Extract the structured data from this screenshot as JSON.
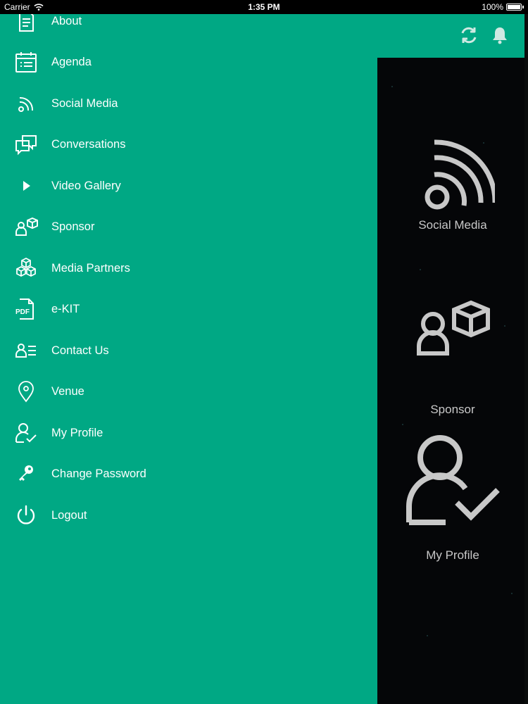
{
  "status_bar": {
    "carrier": "Carrier",
    "time": "1:35 PM",
    "battery": "100%"
  },
  "menu": {
    "items": [
      {
        "label": "About",
        "icon": "document-icon"
      },
      {
        "label": "Agenda",
        "icon": "agenda-icon"
      },
      {
        "label": "Social Media",
        "icon": "rss-icon"
      },
      {
        "label": "Conversations",
        "icon": "chat-icon"
      },
      {
        "label": "Video Gallery",
        "icon": "play-icon"
      },
      {
        "label": "Sponsor",
        "icon": "sponsor-icon"
      },
      {
        "label": "Media Partners",
        "icon": "cubes-icon"
      },
      {
        "label": "e-KIT",
        "icon": "pdf-icon"
      },
      {
        "label": "Contact Us",
        "icon": "contact-icon"
      },
      {
        "label": "Venue",
        "icon": "location-pin-icon"
      },
      {
        "label": "My Profile",
        "icon": "profile-check-icon"
      },
      {
        "label": "Change Password",
        "icon": "key-icon"
      },
      {
        "label": "Logout",
        "icon": "power-icon"
      }
    ]
  },
  "topbar": {
    "icons": [
      "sync-icon",
      "bell-icon"
    ]
  },
  "tiles": [
    {
      "label": "Social Media",
      "icon": "rss-icon"
    },
    {
      "label": "Sponsor",
      "icon": "sponsor-icon"
    },
    {
      "label": "My Profile",
      "icon": "profile-check-icon"
    }
  ],
  "colors": {
    "accent": "#00a884",
    "background": "#050608",
    "tile_text": "#c8c8c8"
  }
}
